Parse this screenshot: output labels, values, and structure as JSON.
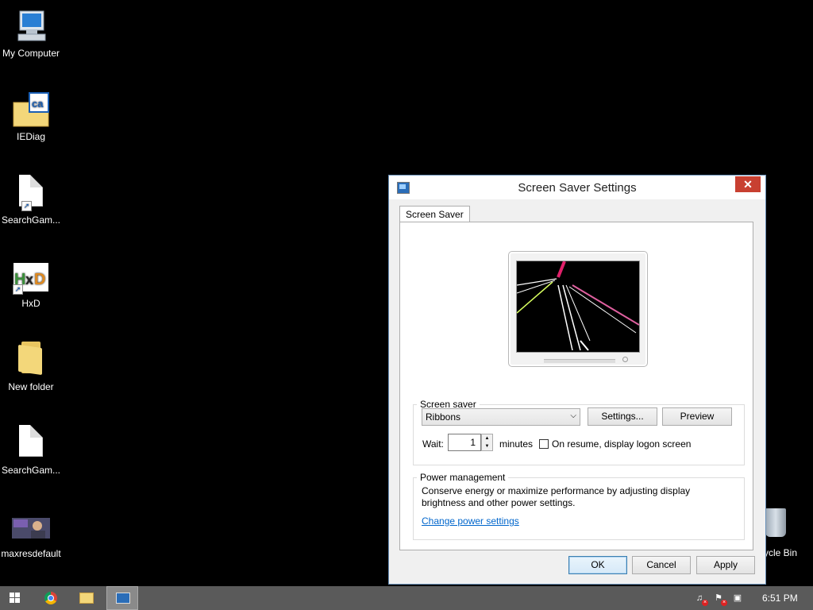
{
  "desktop": {
    "icons": [
      {
        "label": "My Computer"
      },
      {
        "label": "IEDiag"
      },
      {
        "label": "SearchGam..."
      },
      {
        "label": "HxD"
      },
      {
        "label": "New folder"
      },
      {
        "label": "SearchGam..."
      },
      {
        "label": "maxresdefault"
      }
    ],
    "recycle_bin_label": "ycle Bin"
  },
  "dialog": {
    "title": "Screen Saver Settings",
    "close_symbol": "✕",
    "tab_label": "Screen Saver",
    "screen_saver_group": "Screen saver",
    "selected_saver": "Ribbons",
    "settings_button": "Settings...",
    "preview_button": "Preview",
    "wait_label": "Wait:",
    "wait_value": "1",
    "minutes_label": "minutes",
    "resume_checkbox_label": "On resume, display logon screen",
    "resume_checked": false,
    "power_group": "Power management",
    "power_text": "Conserve energy or maximize performance by adjusting display brightness and other power settings.",
    "power_link": "Change power settings",
    "ok_button": "OK",
    "cancel_button": "Cancel",
    "apply_button": "Apply"
  },
  "taskbar": {
    "clock": "6:51 PM",
    "items": [
      "start-icon",
      "chrome-icon",
      "file-explorer-icon",
      "screen-saver-settings-icon"
    ],
    "tray": [
      "volume-muted-icon",
      "action-center-alert-icon",
      "network-icon"
    ]
  },
  "colors": {
    "close_button": "#c84031",
    "link": "#0066cc",
    "taskbar": "#5a5a5a"
  }
}
